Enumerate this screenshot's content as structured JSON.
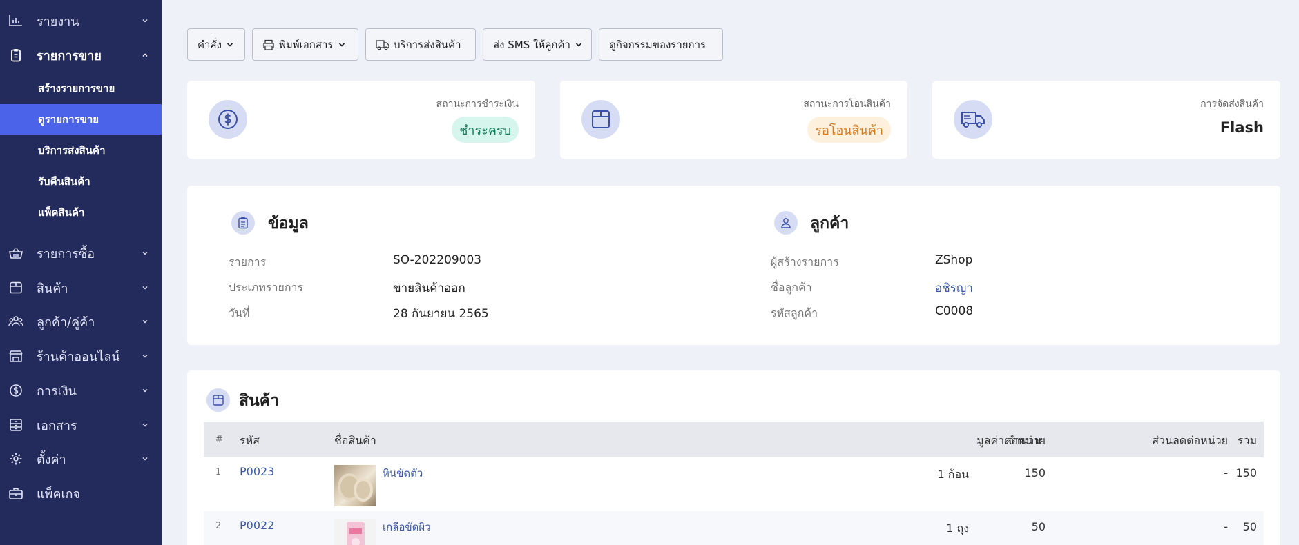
{
  "sidebar": {
    "items": [
      {
        "label": "รายงาน",
        "icon": "chart-bars-icon",
        "expanded": false
      },
      {
        "label": "รายการขาย",
        "icon": "clipboard-icon",
        "expanded": true
      },
      {
        "label": "รายการซื้อ",
        "icon": "basket-icon",
        "expanded": false
      },
      {
        "label": "สินค้า",
        "icon": "box-icon",
        "expanded": false
      },
      {
        "label": "ลูกค้า/คู่ค้า",
        "icon": "users-icon",
        "expanded": false
      },
      {
        "label": "ร้านค้าออนไลน์",
        "icon": "store-icon",
        "expanded": false
      },
      {
        "label": "การเงิน",
        "icon": "coin-icon",
        "expanded": false
      },
      {
        "label": "เอกสาร",
        "icon": "document-icon",
        "expanded": false
      },
      {
        "label": "ตั้งค่า",
        "icon": "gear-icon",
        "expanded": false
      },
      {
        "label": "แพ็คเกจ",
        "icon": "briefcase-icon",
        "expanded": false
      }
    ],
    "sub_items": [
      {
        "label": "สร้างรายการขาย",
        "selected": false
      },
      {
        "label": "ดูรายการขาย",
        "selected": true
      },
      {
        "label": "บริการส่งสินค้า",
        "selected": false
      },
      {
        "label": "รับคืนสินค้า",
        "selected": false
      },
      {
        "label": "แพ็คสินค้า",
        "selected": false
      }
    ]
  },
  "toolbar": {
    "command": "คำสั่ง",
    "print": "พิมพ์เอกสาร",
    "shipping": "บริการส่งสินค้า",
    "sms": "ส่ง SMS ให้ลูกค้า",
    "activity": "ดูกิจกรรมของรายการ"
  },
  "status": {
    "payment": {
      "label": "สถานะการชำระเงิน",
      "value": "ชำระครบ",
      "color": "#127a56"
    },
    "transfer": {
      "label": "สถานะการโอนสินค้า",
      "value": "รอโอนสินค้า",
      "color": "#d9791f"
    },
    "shipping": {
      "label": "การจัดส่งสินค้า",
      "value": "Flash"
    }
  },
  "info": {
    "title": "ข้อมูล",
    "rows": [
      {
        "label": "รายการ",
        "value": "SO-202209003"
      },
      {
        "label": "ประเภทรายการ",
        "value": "ขายสินค้าออก"
      },
      {
        "label": "วันที่",
        "value": "28 กันยายน 2565"
      }
    ]
  },
  "customer": {
    "title": "ลูกค้า",
    "rows": [
      {
        "label": "ผู้สร้างรายการ",
        "value": "ZShop"
      },
      {
        "label": "ชื่อลูกค้า",
        "value": "อชิรญา"
      },
      {
        "label": "รหัสลูกค้า",
        "value": "C0008"
      }
    ]
  },
  "products": {
    "title": "สินค้า",
    "columns": [
      "#",
      "รหัส",
      "ชื่อสินค้า",
      "จำนวน",
      "มูลค่าต่อหน่วย",
      "ส่วนลดต่อหน่วย",
      "รวม"
    ],
    "rows": [
      {
        "no": "1",
        "code": "P0023",
        "name": "หินขัดตัว",
        "qty": "1 ก้อน",
        "unit_price": "150",
        "discount": "-",
        "total": "150"
      },
      {
        "no": "2",
        "code": "P0022",
        "name": "เกลือขัดผิว",
        "qty": "1 ถุง",
        "unit_price": "50",
        "discount": "-",
        "total": "50"
      }
    ]
  },
  "colors": {
    "sidebar": "#232a5c",
    "selected": "#4a63e8",
    "link": "#3d5aa8"
  }
}
